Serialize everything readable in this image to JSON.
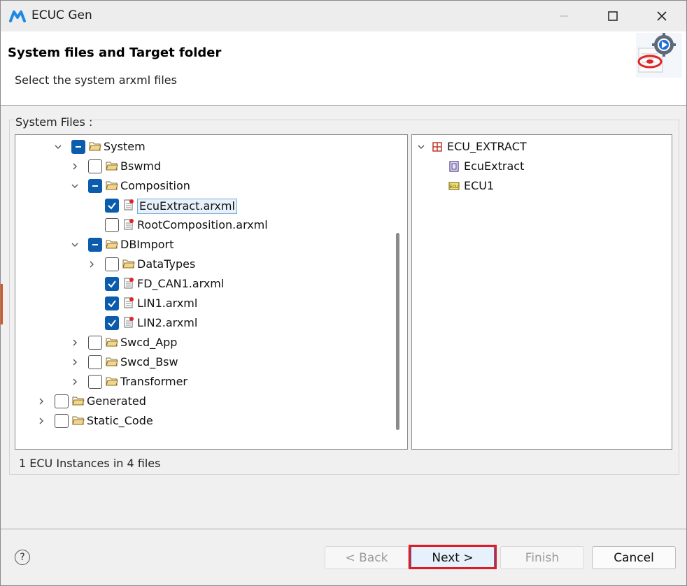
{
  "window": {
    "title": "ECUC Gen",
    "controls": [
      "minimize",
      "maximize",
      "close"
    ]
  },
  "header": {
    "title": "System files and Target folder",
    "description": "Select the system arxml files"
  },
  "system_files": {
    "label": "System Files :",
    "tree": [
      {
        "label": "System",
        "expander": "expanded",
        "check": "partial",
        "kind": "folder"
      },
      {
        "label": "Bswmd",
        "expander": "collapsed",
        "check": "unchecked",
        "kind": "folder"
      },
      {
        "label": "Composition",
        "expander": "expanded",
        "check": "partial",
        "kind": "folder"
      },
      {
        "label": "EcuExtract.arxml",
        "expander": "none",
        "check": "checked",
        "kind": "file",
        "selected": true
      },
      {
        "label": "RootComposition.arxml",
        "expander": "none",
        "check": "unchecked",
        "kind": "file"
      },
      {
        "label": "DBImport",
        "expander": "expanded",
        "check": "partial",
        "kind": "folder"
      },
      {
        "label": "DataTypes",
        "expander": "collapsed",
        "check": "unchecked",
        "kind": "folder"
      },
      {
        "label": "FD_CAN1.arxml",
        "expander": "none",
        "check": "checked",
        "kind": "file"
      },
      {
        "label": "LIN1.arxml",
        "expander": "none",
        "check": "checked",
        "kind": "file"
      },
      {
        "label": "LIN2.arxml",
        "expander": "none",
        "check": "checked",
        "kind": "file"
      },
      {
        "label": "Swcd_App",
        "expander": "collapsed",
        "check": "unchecked",
        "kind": "folder"
      },
      {
        "label": "Swcd_Bsw",
        "expander": "collapsed",
        "check": "unchecked",
        "kind": "folder"
      },
      {
        "label": "Transformer",
        "expander": "collapsed",
        "check": "unchecked",
        "kind": "folder"
      },
      {
        "label": "Generated",
        "expander": "collapsed",
        "check": "unchecked",
        "kind": "folder"
      },
      {
        "label": "Static_Code",
        "expander": "collapsed",
        "check": "unchecked",
        "kind": "folder"
      }
    ]
  },
  "ecu_tree": [
    {
      "label": "ECU_EXTRACT",
      "expander": "expanded",
      "icon": "package-icon"
    },
    {
      "label": "EcuExtract",
      "expander": "none",
      "icon": "ecu-extract-icon"
    },
    {
      "label": "ECU1",
      "expander": "none",
      "icon": "ecu-instance-icon",
      "icon_text": "ECU"
    }
  ],
  "status": "1 ECU Instances in 4 files",
  "buttons": {
    "back": "< Back",
    "next": "Next >",
    "finish": "Finish",
    "cancel": "Cancel",
    "help": "?"
  },
  "colors": {
    "accent": "#0b5cad",
    "highlight": "#e01b24",
    "selection_bg": "#e6f1fb"
  }
}
